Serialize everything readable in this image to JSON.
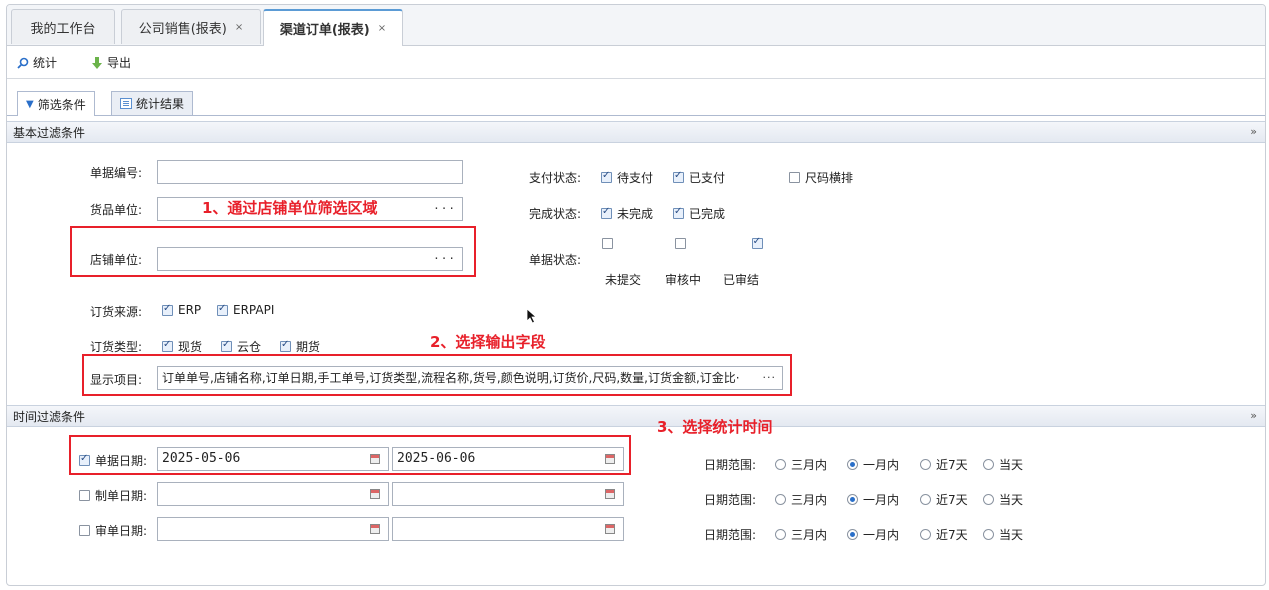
{
  "tabs": [
    {
      "label": "我的工作台",
      "closable": false
    },
    {
      "label": "公司销售(报表)",
      "closable": true
    },
    {
      "label": "渠道订单(报表)",
      "closable": true
    }
  ],
  "close_glyph": "×",
  "toolbar": {
    "stat_label": "统计",
    "export_label": "导出"
  },
  "subtabs": {
    "filter_label": "筛选条件",
    "result_label": "统计结果"
  },
  "basic": {
    "header": "基本过滤条件",
    "doc_no_label": "单据编号:",
    "goods_unit_label": "货品单位:",
    "store_unit_label": "店铺单位:",
    "order_source_label": "订货来源:",
    "order_source_opts": [
      "ERP",
      "ERPAPI"
    ],
    "order_type_label": "订货类型:",
    "order_type_opts": [
      "现货",
      "云仓",
      "期货"
    ],
    "display_label": "显示项目:",
    "display_value": "订单单号,店铺名称,订单日期,手工单号,订货类型,流程名称,货号,颜色说明,订货价,尺码,数量,订货金额,订金比·",
    "pay_label": "支付状态:",
    "pay_opts": [
      "待支付",
      "已支付"
    ],
    "size_h_label": "尺码横排",
    "finish_label": "完成状态:",
    "finish_opts": [
      "未完成",
      "已完成"
    ],
    "doc_status_label": "单据状态:",
    "doc_status_opts": [
      "未提交",
      "审核中",
      "已审结"
    ],
    "dots": "···"
  },
  "time": {
    "header": "时间过滤条件",
    "rows": [
      {
        "label": "单据日期:",
        "checked": true,
        "from": "2025-05-06",
        "to": "2025-06-06"
      },
      {
        "label": "制单日期:",
        "checked": false,
        "from": "",
        "to": ""
      },
      {
        "label": "审单日期:",
        "checked": false,
        "from": "",
        "to": ""
      }
    ],
    "range_label": "日期范围:",
    "range_opts": [
      "三月内",
      "一月内",
      "近7天",
      "当天"
    ],
    "selected_range": "一月内"
  },
  "annotations": {
    "note1": "1、通过店铺单位筛选区域",
    "note2": "2、选择输出字段",
    "note3": "3、选择统计时间"
  },
  "chevron": "»"
}
